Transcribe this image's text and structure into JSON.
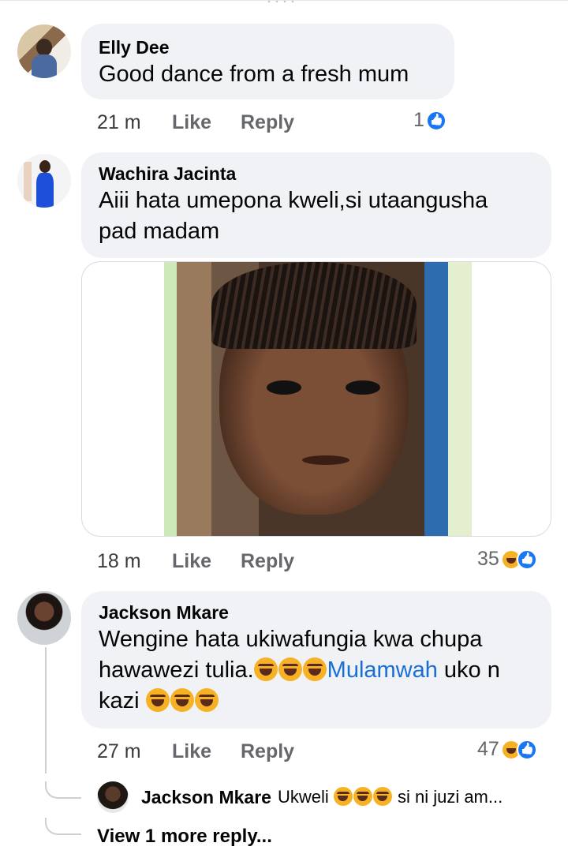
{
  "comments": [
    {
      "author": "Elly Dee",
      "text": "Good dance from a fresh mum",
      "time": "21 m",
      "like_label": "Like",
      "reply_label": "Reply",
      "reaction_count": "1",
      "reactions": [
        "like-icon"
      ]
    },
    {
      "author": "Wachira Jacinta",
      "text": "Aiii hata umepona kweli,si utaangusha pad madam",
      "time": "18 m",
      "like_label": "Like",
      "reply_label": "Reply",
      "reaction_count": "35",
      "reactions": [
        "haha-icon",
        "like-icon"
      ],
      "attachment": "photo of a young girl frowning"
    },
    {
      "author": "Jackson Mkare",
      "text_part1": "Wengine hata ukiwafungia kwa chupa hawawezi tulia.",
      "mention": "Mulamwah",
      "text_part2": " uko n kazi ",
      "time": "27 m",
      "like_label": "Like",
      "reply_label": "Reply",
      "reaction_count": "47",
      "reactions": [
        "haha-icon",
        "like-icon"
      ]
    }
  ],
  "reply_preview": {
    "author": "Jackson Mkare",
    "text_start": "Ukweli ",
    "text_end": " si ni juzi am..."
  },
  "view_more_label": "View 1 more reply...",
  "colors": {
    "bubble": "#f0f2f5",
    "link": "#1a6ed8",
    "like": "#1877f2",
    "haha": "#f7b125"
  }
}
